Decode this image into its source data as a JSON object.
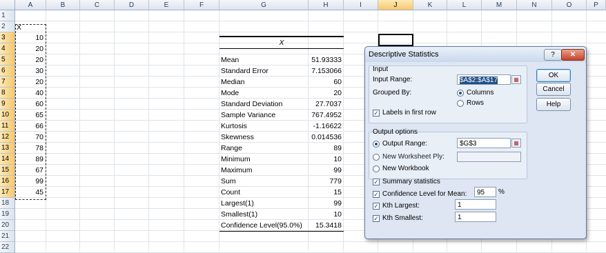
{
  "sheet": {
    "columns": [
      "A",
      "B",
      "C",
      "D",
      "E",
      "F",
      "G",
      "H",
      "I",
      "J",
      "K",
      "L",
      "M",
      "N",
      "O",
      "P"
    ],
    "rows": [
      "1",
      "2",
      "3",
      "4",
      "5",
      "6",
      "7",
      "8",
      "9",
      "10",
      "11",
      "12",
      "13",
      "14",
      "15",
      "16",
      "17",
      "18",
      "19",
      "20",
      "21",
      "22"
    ],
    "data_header": "X",
    "data_values": [
      "10",
      "20",
      "20",
      "30",
      "20",
      "40",
      "60",
      "65",
      "66",
      "70",
      "78",
      "89",
      "67",
      "99",
      "45"
    ],
    "output_header": "X",
    "stats": [
      {
        "label": "Mean",
        "value": "51.93333"
      },
      {
        "label": "Standard Error",
        "value": "7.153066"
      },
      {
        "label": "Median",
        "value": "60"
      },
      {
        "label": "Mode",
        "value": "20"
      },
      {
        "label": "Standard Deviation",
        "value": "27.7037"
      },
      {
        "label": "Sample Variance",
        "value": "767.4952"
      },
      {
        "label": "Kurtosis",
        "value": "-1.16622"
      },
      {
        "label": "Skewness",
        "value": "0.014536"
      },
      {
        "label": "Range",
        "value": "89"
      },
      {
        "label": "Minimum",
        "value": "10"
      },
      {
        "label": "Maximum",
        "value": "99"
      },
      {
        "label": "Sum",
        "value": "779"
      },
      {
        "label": "Count",
        "value": "15"
      },
      {
        "label": "Largest(1)",
        "value": "99"
      },
      {
        "label": "Smallest(1)",
        "value": "10"
      },
      {
        "label": "Confidence Level(95.0%)",
        "value": "15.3418"
      }
    ]
  },
  "dialog": {
    "title": "Descriptive Statistics",
    "help_glyph": "?",
    "close_glyph": "✕",
    "input_group": "Input",
    "input_range_label": "Input Range:",
    "input_range_value": "$A$2:$A$17",
    "grouped_by_label": "Grouped By:",
    "columns_label": "Columns",
    "rows_label": "Rows",
    "labels_first_row": "Labels in first row",
    "output_group": "Output options",
    "output_range_label": "Output Range:",
    "output_range_value": "$G$3",
    "new_ply_label": "New Worksheet Ply:",
    "new_workbook_label": "New Workbook",
    "summary_stats_label": "Summary statistics",
    "confidence_label": "Confidence Level for Mean:",
    "confidence_value": "95",
    "percent": "%",
    "kth_largest_label": "Kth Largest:",
    "kth_largest_value": "1",
    "kth_smallest_label": "Kth Smallest:",
    "kth_smallest_value": "1",
    "ok": "OK",
    "cancel": "Cancel",
    "help": "Help"
  }
}
